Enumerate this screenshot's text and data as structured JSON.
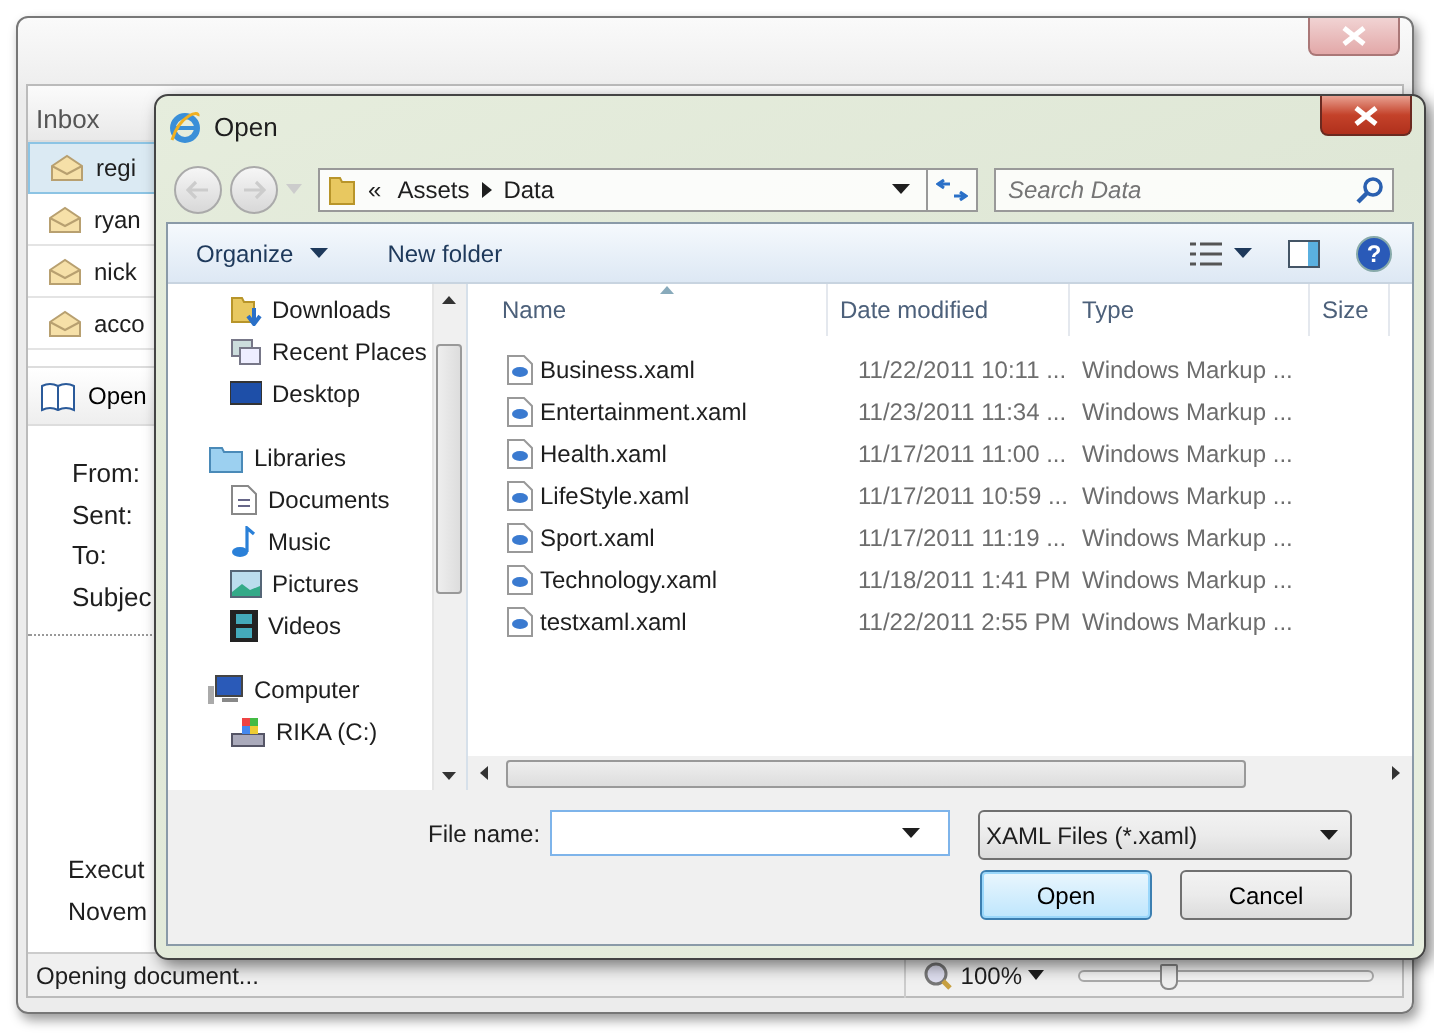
{
  "main_window": {
    "inbox": {
      "title": "Inbox",
      "messages": [
        {
          "sender": "regi",
          "selected": true
        },
        {
          "sender": "ryan",
          "selected": false
        },
        {
          "sender": "nick",
          "selected": false
        },
        {
          "sender": "acco",
          "selected": false
        }
      ]
    },
    "toolbar": {
      "open_button": "Open"
    },
    "header_fields": [
      "From:",
      "Sent:",
      "To:",
      "Subjec"
    ],
    "body_lines": [
      "Execut",
      "Novem"
    ],
    "status_bar": {
      "text": "Opening document...",
      "zoom": "100%",
      "zoom_slider": {
        "level": 0.31
      }
    }
  },
  "dialog": {
    "title": "Open",
    "breadcrumb": {
      "overflow": "«",
      "parts": [
        "Assets",
        "Data"
      ]
    },
    "search": {
      "placeholder": "Search Data"
    },
    "toolbar": {
      "organize": "Organize",
      "new_folder": "New folder"
    },
    "nav_pane": {
      "groups": [
        {
          "children": [
            {
              "label": "Downloads"
            },
            {
              "label": "Recent Places"
            },
            {
              "label": "Desktop"
            }
          ]
        },
        {
          "label": "Libraries",
          "children": [
            {
              "label": "Documents"
            },
            {
              "label": "Music"
            },
            {
              "label": "Pictures"
            },
            {
              "label": "Videos"
            }
          ]
        },
        {
          "label": "Computer",
          "children": [
            {
              "label": "RIKA (C:)"
            }
          ]
        }
      ]
    },
    "file_list": {
      "columns": [
        "Name",
        "Date modified",
        "Type",
        "Size"
      ],
      "rows": [
        {
          "name": "Business.xaml",
          "date": "11/22/2011 10:11 ...",
          "type": "Windows Markup ..."
        },
        {
          "name": "Entertainment.xaml",
          "date": "11/23/2011 11:34 ...",
          "type": "Windows Markup ..."
        },
        {
          "name": "Health.xaml",
          "date": "11/17/2011 11:00 ...",
          "type": "Windows Markup ..."
        },
        {
          "name": "LifeStyle.xaml",
          "date": "11/17/2011 10:59 ...",
          "type": "Windows Markup ..."
        },
        {
          "name": "Sport.xaml",
          "date": "11/17/2011 11:19 ...",
          "type": "Windows Markup ..."
        },
        {
          "name": "Technology.xaml",
          "date": "11/18/2011 1:41 PM",
          "type": "Windows Markup ..."
        },
        {
          "name": "testxaml.xaml",
          "date": "11/22/2011 2:55 PM",
          "type": "Windows Markup ..."
        }
      ]
    },
    "help_button": "?",
    "file_name": {
      "label": "File name:"
    },
    "file_type": "XAML Files (*.xaml)",
    "buttons": {
      "open": "Open",
      "cancel": "Cancel"
    }
  }
}
